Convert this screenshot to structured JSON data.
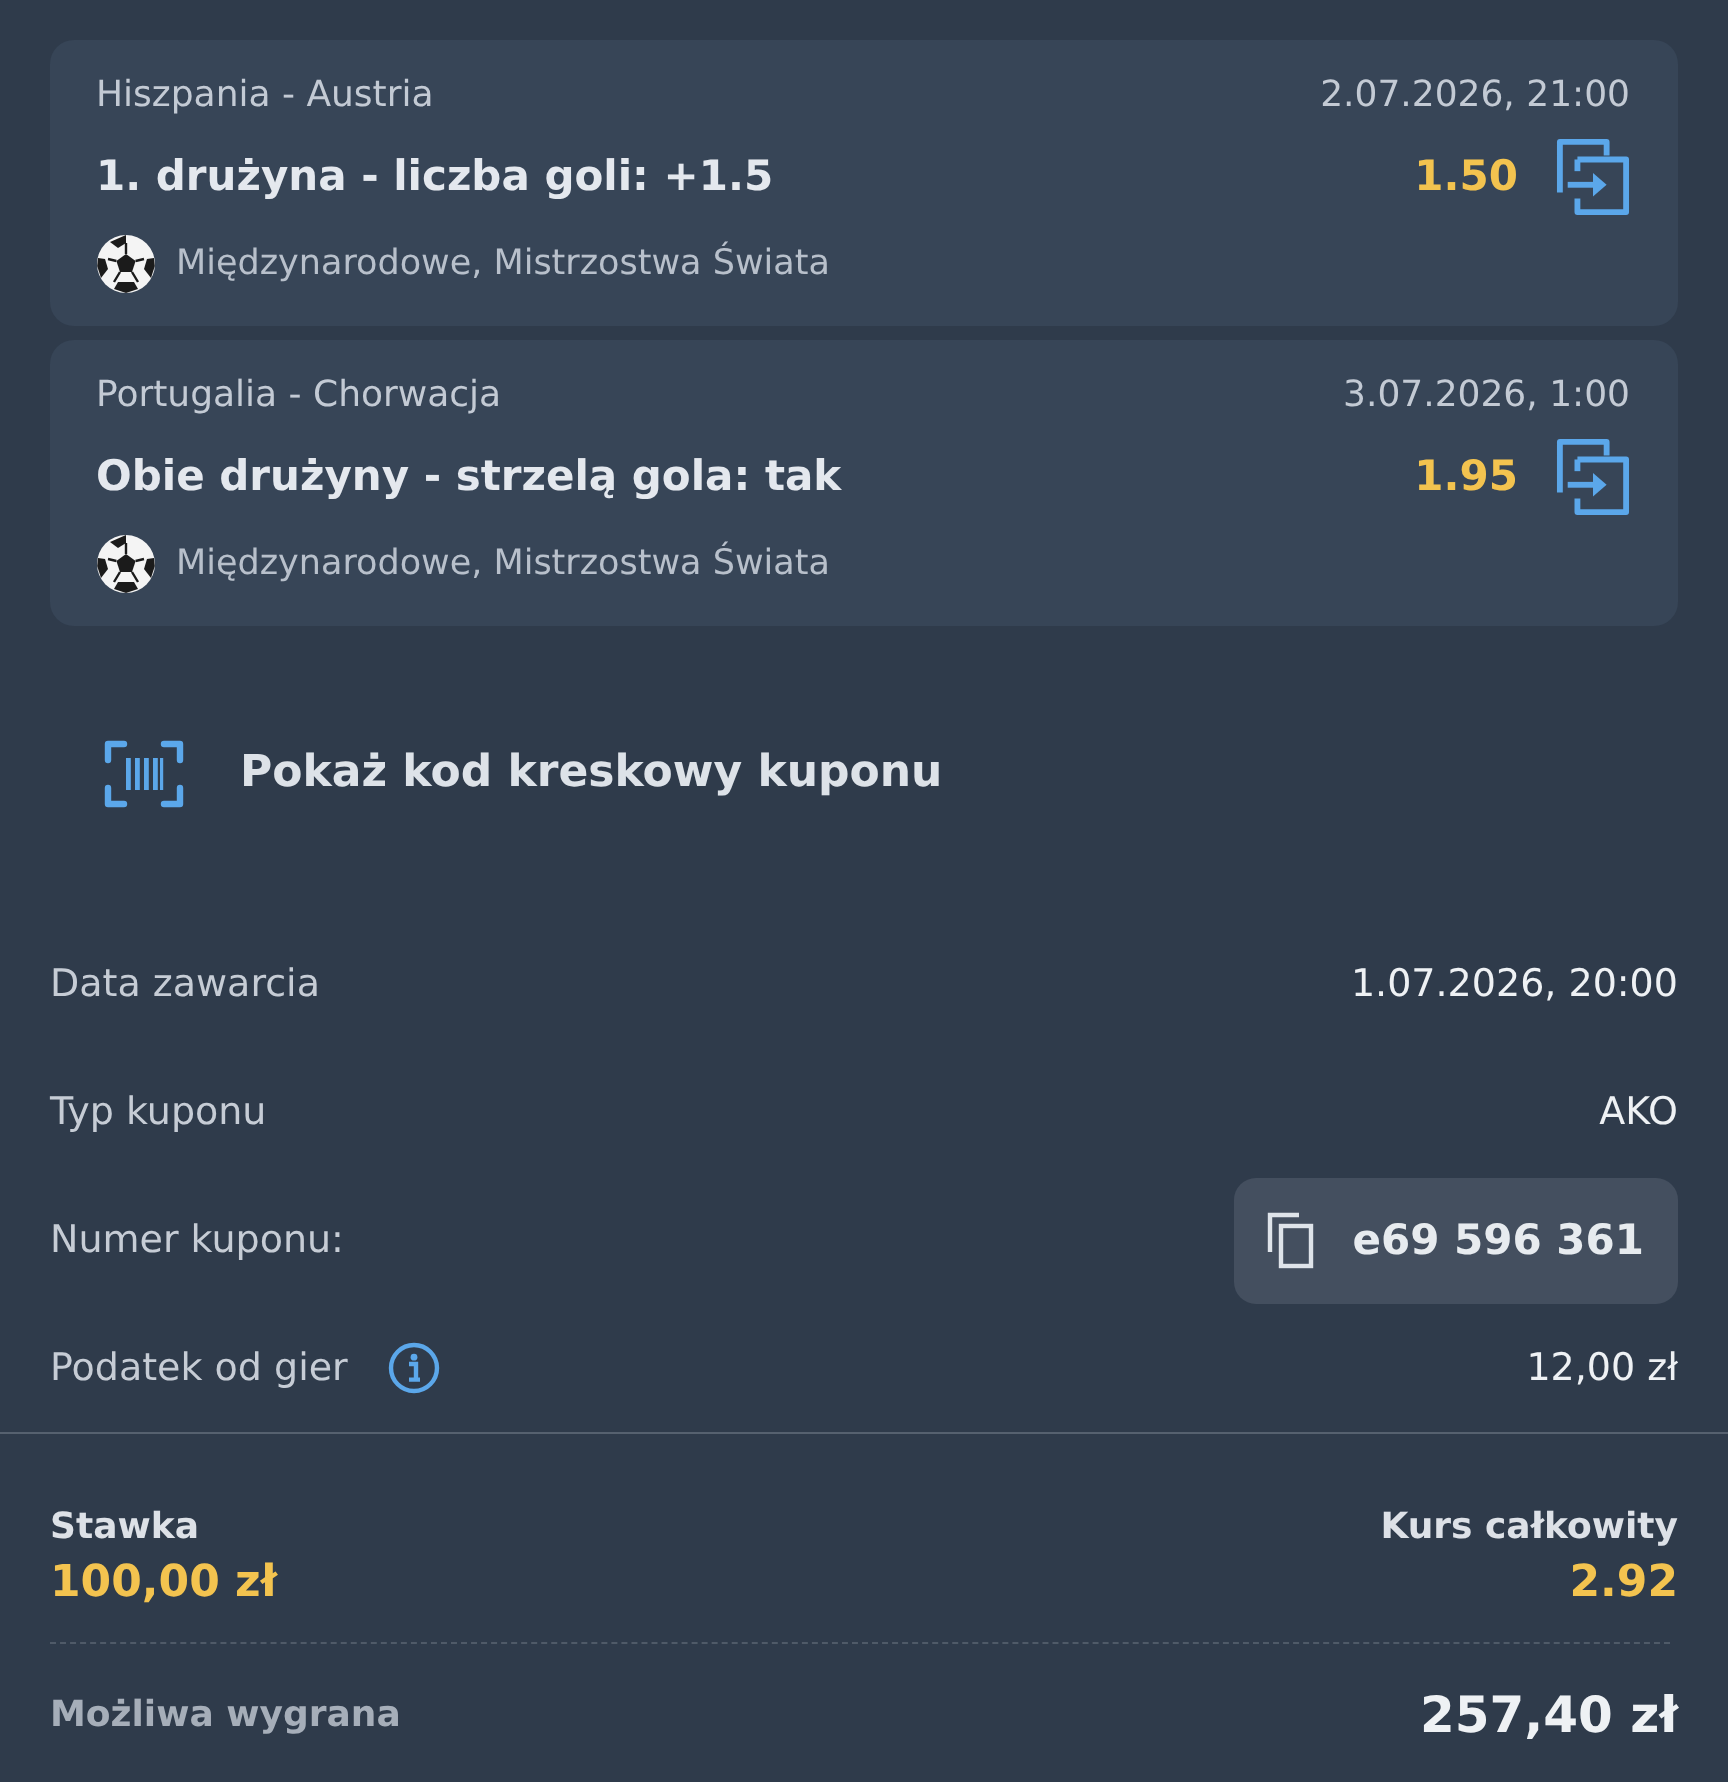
{
  "bets": [
    {
      "match": "Hiszpania - Austria",
      "datetime": "2.07.2026, 21:00",
      "selection": "1. drużyna - liczba goli: +1.5",
      "odds": "1.50",
      "league": "Międzynarodowe, Mistrzostwa Świata"
    },
    {
      "match": "Portugalia - Chorwacja",
      "datetime": "3.07.2026, 1:00",
      "selection": "Obie drużyny - strzelą gola: tak",
      "odds": "1.95",
      "league": "Międzynarodowe, Mistrzostwa Świata"
    }
  ],
  "barcode_button": {
    "label": "Pokaż kod kreskowy kuponu"
  },
  "details": [
    {
      "kind": "text",
      "label": "Data zawarcia",
      "value": "1.07.2026, 20:00"
    },
    {
      "kind": "text",
      "label": "Typ kuponu",
      "value": "AKO"
    },
    {
      "kind": "copy",
      "label": "Numer kuponu:",
      "value": "e69 596 361"
    },
    {
      "kind": "info",
      "label": "Podatek od gier",
      "value": "12,00 zł"
    }
  ],
  "summary": {
    "stake_label": "Stawka",
    "stake": "100,00 zł",
    "total_odds_label": "Kurs całkowity",
    "total_odds": "2.92",
    "win_label": "Możliwa wygrana",
    "win": "257,40 zł"
  }
}
